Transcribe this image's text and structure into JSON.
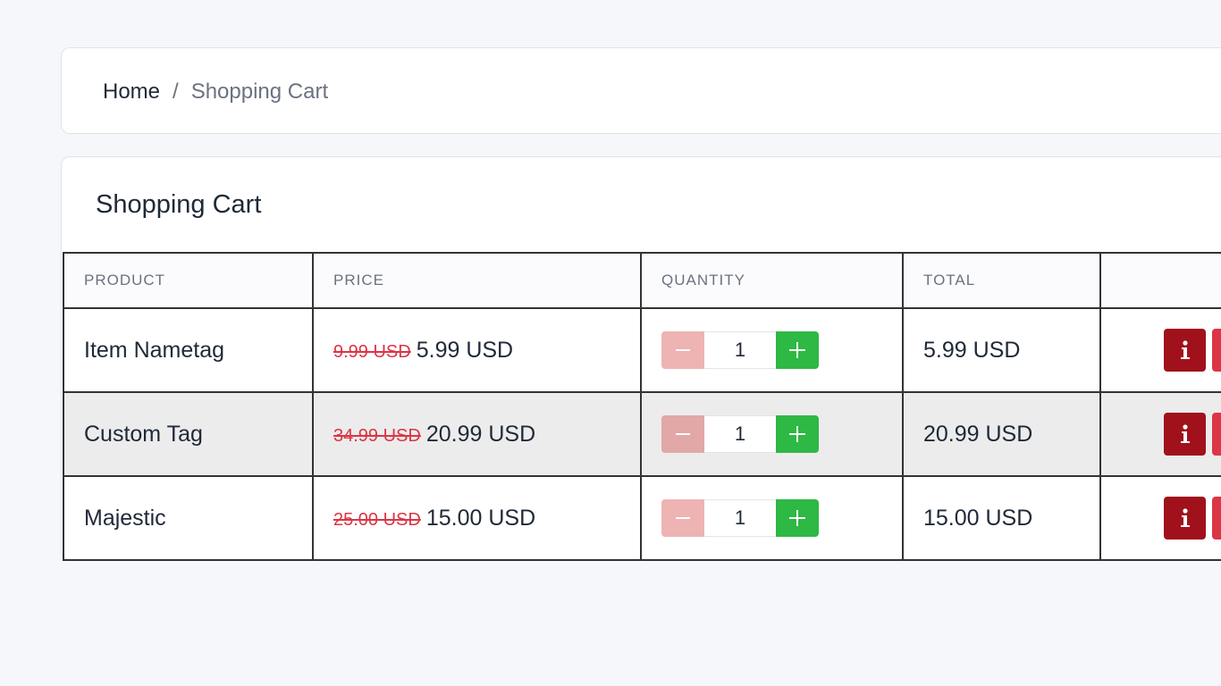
{
  "breadcrumb": {
    "home": "Home",
    "separator": "/",
    "current": "Shopping Cart"
  },
  "cart": {
    "title": "Shopping Cart",
    "columns": {
      "product": "PRODUCT",
      "price": "PRICE",
      "quantity": "QUANTITY",
      "total": "TOTAL",
      "actions": ""
    },
    "rows": [
      {
        "product": "Item Nametag",
        "old_price": "9.99 USD",
        "price": "5.99 USD",
        "quantity": "1",
        "total": "5.99 USD"
      },
      {
        "product": "Custom Tag",
        "old_price": "34.99 USD",
        "price": "20.99 USD",
        "quantity": "1",
        "total": "20.99 USD"
      },
      {
        "product": "Majestic",
        "old_price": "25.00 USD",
        "price": "15.00 USD",
        "quantity": "1",
        "total": "15.00 USD"
      }
    ]
  },
  "icons": {
    "decrement": "minus-icon",
    "increment": "plus-icon",
    "info": "info-icon",
    "delete": "trash-icon"
  },
  "colors": {
    "old_price": "#dc3545",
    "decrement_button": "#eeb3b3",
    "increment_button": "#2eb844",
    "info_button": "#a0111b",
    "delete_button": "#dc3545"
  }
}
